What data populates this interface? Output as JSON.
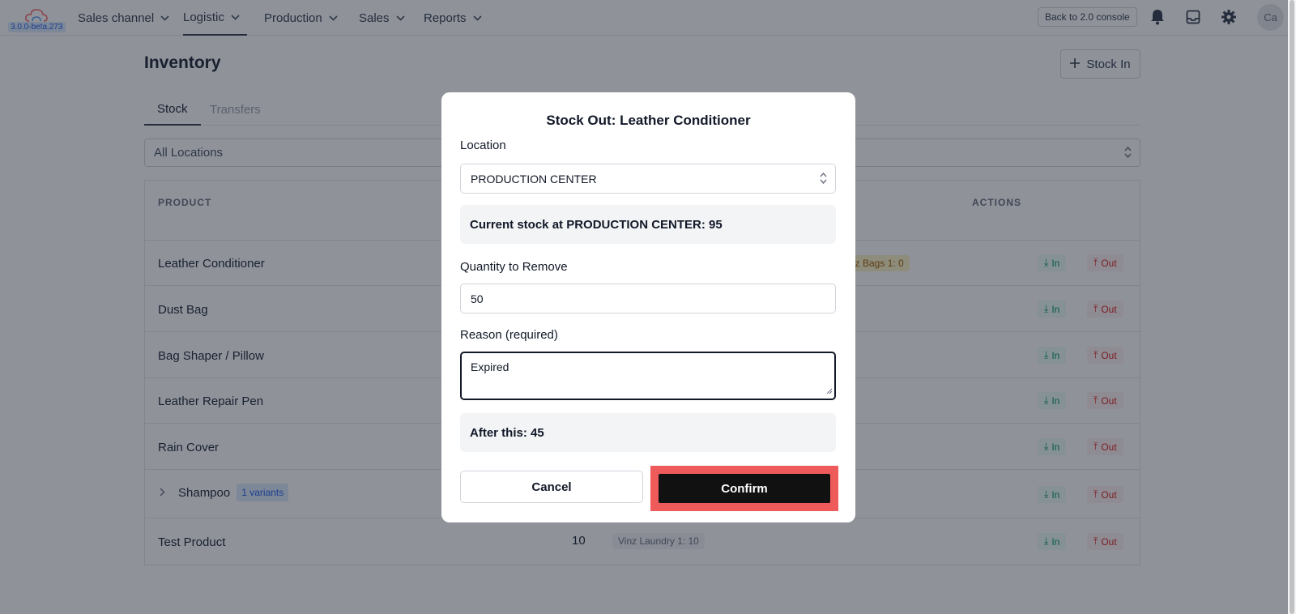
{
  "app": {
    "version": "3.0.0-beta.273"
  },
  "nav": {
    "items": [
      {
        "label": "Sales channel"
      },
      {
        "label": "Logistic"
      },
      {
        "label": "Production"
      },
      {
        "label": "Sales"
      },
      {
        "label": "Reports"
      }
    ],
    "back_console": "Back to 2.0 console",
    "avatar_initials": "Ca"
  },
  "page": {
    "title": "Inventory",
    "stock_in_label": "Stock In",
    "tabs": [
      {
        "label": "Stock"
      },
      {
        "label": "Transfers"
      }
    ],
    "location_filter": "All Locations"
  },
  "table": {
    "headers": {
      "product": "PRODUCT",
      "actions": "ACTIONS"
    },
    "action_in": "In",
    "action_out": "Out",
    "rows": [
      {
        "name": "Leather Conditioner",
        "qty": "",
        "tag": "nz Bags 1: 0"
      },
      {
        "name": "Dust Bag",
        "qty": "",
        "tag": ""
      },
      {
        "name": "Bag Shaper / Pillow",
        "qty": "",
        "tag": ""
      },
      {
        "name": "Leather Repair Pen",
        "qty": "",
        "tag": ""
      },
      {
        "name": "Rain Cover",
        "qty": "",
        "tag": ""
      },
      {
        "name": "Shampoo",
        "qty": "",
        "tag": "",
        "variants": "1 variants"
      },
      {
        "name": "Test Product",
        "qty": "10",
        "tag": "Vinz Laundry 1: 10"
      }
    ]
  },
  "modal": {
    "title": "Stock Out: Leather Conditioner",
    "location_label": "Location",
    "location_value": "PRODUCTION CENTER",
    "current_stock": "Current stock at PRODUCTION CENTER: 95",
    "quantity_label": "Quantity to Remove",
    "quantity_value": "50",
    "reason_label": "Reason (required)",
    "reason_value": "Expired",
    "after_text": "After this: 45",
    "cancel_label": "Cancel",
    "confirm_label": "Confirm"
  },
  "colors": {
    "confirm_highlight": "#ef5a5a",
    "in_action": "#059669",
    "out_action": "#dc2626",
    "variant_badge": "#2563eb"
  }
}
